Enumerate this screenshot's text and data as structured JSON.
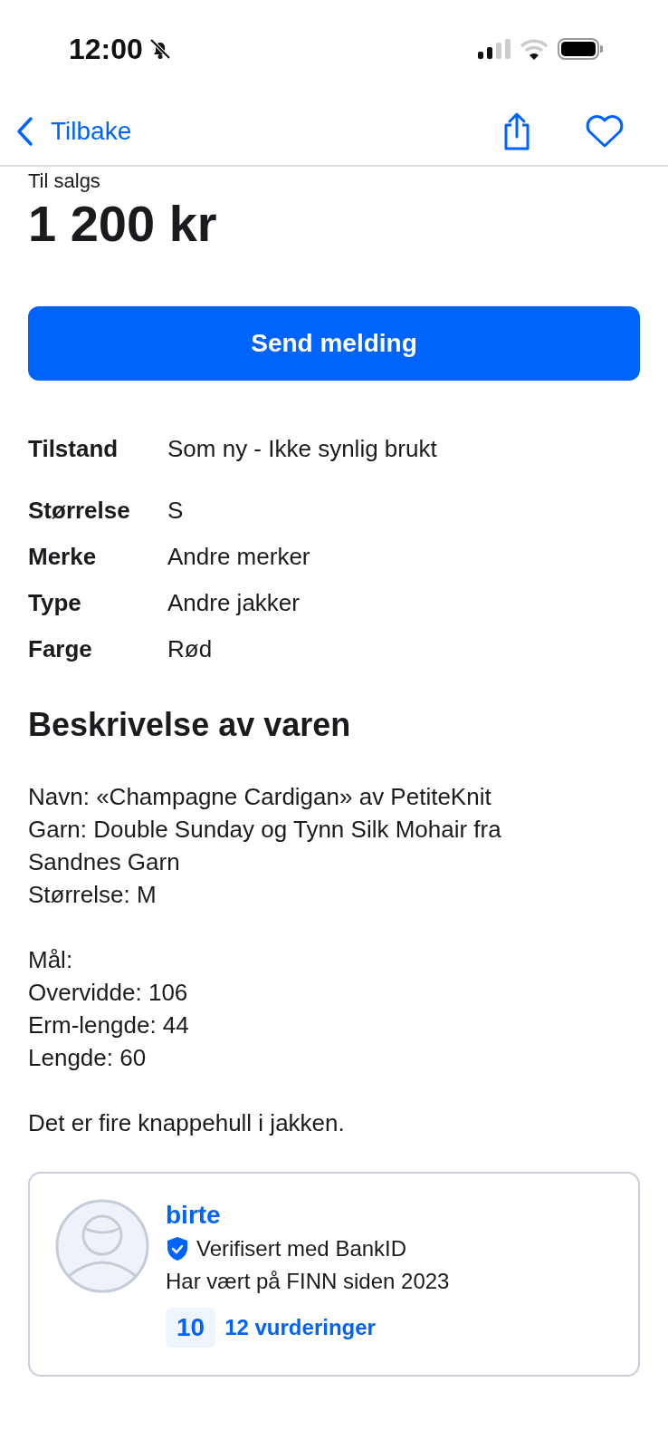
{
  "status_bar": {
    "time": "12:00",
    "silent": true
  },
  "nav": {
    "back_label": "Tilbake",
    "favorite": false
  },
  "listing": {
    "status": "Til salgs",
    "price": "1 200 kr",
    "message_button": "Send melding"
  },
  "specs": [
    {
      "label": "Tilstand",
      "value": "Som ny - Ikke synlig brukt"
    },
    {
      "label": "Størrelse",
      "value": "S"
    },
    {
      "label": "Merke",
      "value": "Andre merker"
    },
    {
      "label": "Type",
      "value": "Andre jakker"
    },
    {
      "label": "Farge",
      "value": "Rød"
    }
  ],
  "description": {
    "heading": "Beskrivelse av varen",
    "paragraphs": [
      [
        "Navn: «Champagne Cardigan» av PetiteKnit",
        "Garn: Double Sunday og Tynn Silk Mohair fra Sandnes Garn",
        "Størrelse: M"
      ],
      [
        "Mål:",
        "Overvidde: 106",
        "Erm-lengde: 44",
        "Lengde: 60"
      ],
      [
        "Det er fire knappehull i jakken."
      ]
    ]
  },
  "seller": {
    "name": "birte",
    "verified": true,
    "verified_label": "Verifisert med BankID",
    "member_since": "Har vært på FINN siden 2023",
    "score": "10",
    "reviews": "12 vurderinger"
  }
}
